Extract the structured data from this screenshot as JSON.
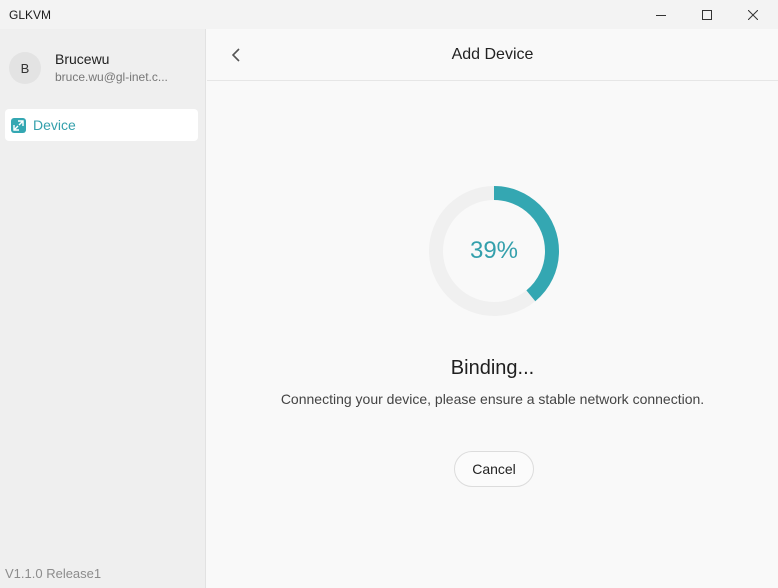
{
  "app": {
    "title": "GLKVM"
  },
  "window_controls": {
    "minimize_icon": "minimize-icon",
    "maximize_icon": "maximize-icon",
    "close_icon": "close-icon"
  },
  "user": {
    "avatar_initial": "B",
    "name": "Brucewu",
    "email": "bruce.wu@gl-inet.c..."
  },
  "sidebar": {
    "items": [
      {
        "label": "Device",
        "icon": "device-remote-icon",
        "active": true
      }
    ],
    "version": "V1.1.0 Release1"
  },
  "header": {
    "title": "Add Device",
    "back_icon": "chevron-left-icon"
  },
  "progress": {
    "percent": 39,
    "label": "39%"
  },
  "status": {
    "title": "Binding...",
    "description": "Connecting your device, please ensure a stable network connection."
  },
  "actions": {
    "cancel_label": "Cancel"
  },
  "colors": {
    "accent": "#34a7b2",
    "track": "#f0f0f0"
  }
}
